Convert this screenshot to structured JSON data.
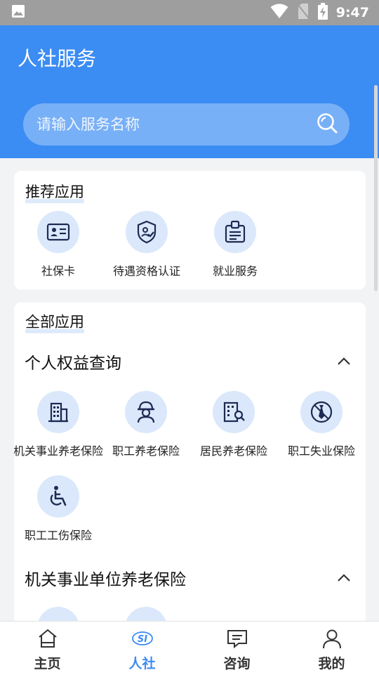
{
  "status_bar": {
    "time": "9:47",
    "icons": [
      "image-icon",
      "wifi-icon",
      "no-sim-icon",
      "battery-charging-icon"
    ]
  },
  "header": {
    "title": "人社服务"
  },
  "search": {
    "placeholder": "请输入服务名称",
    "icon": "search-icon"
  },
  "recommend": {
    "title": "推荐应用",
    "items": [
      {
        "label": "社保卡",
        "icon": "id-card-icon"
      },
      {
        "label": "待遇资格认证",
        "icon": "shield-check-icon"
      },
      {
        "label": "就业服务",
        "icon": "badge-icon"
      }
    ]
  },
  "all_apps": {
    "title": "全部应用",
    "sections": [
      {
        "title": "个人权益查询",
        "expanded": true,
        "items": [
          {
            "label": "机关事业养老保险",
            "icon": "office-building-icon"
          },
          {
            "label": "职工养老保险",
            "icon": "worker-helmet-icon"
          },
          {
            "label": "居民养老保险",
            "icon": "resident-search-icon"
          },
          {
            "label": "职工失业保险",
            "icon": "unemployment-tie-icon"
          },
          {
            "label": "职工工伤保险",
            "icon": "wheelchair-icon"
          }
        ]
      },
      {
        "title": "机关事业单位养老保险",
        "expanded": true
      }
    ]
  },
  "bottom_nav": {
    "active": 1,
    "items": [
      {
        "label": "主页",
        "icon": "home-icon"
      },
      {
        "label": "人社",
        "icon": "si-logo-icon"
      },
      {
        "label": "咨询",
        "icon": "chat-icon"
      },
      {
        "label": "我的",
        "icon": "user-icon"
      }
    ]
  },
  "colors": {
    "primary": "#3b8cf3",
    "icon_bg": "#dbe8fb",
    "icon_stroke": "#1e2a52"
  }
}
